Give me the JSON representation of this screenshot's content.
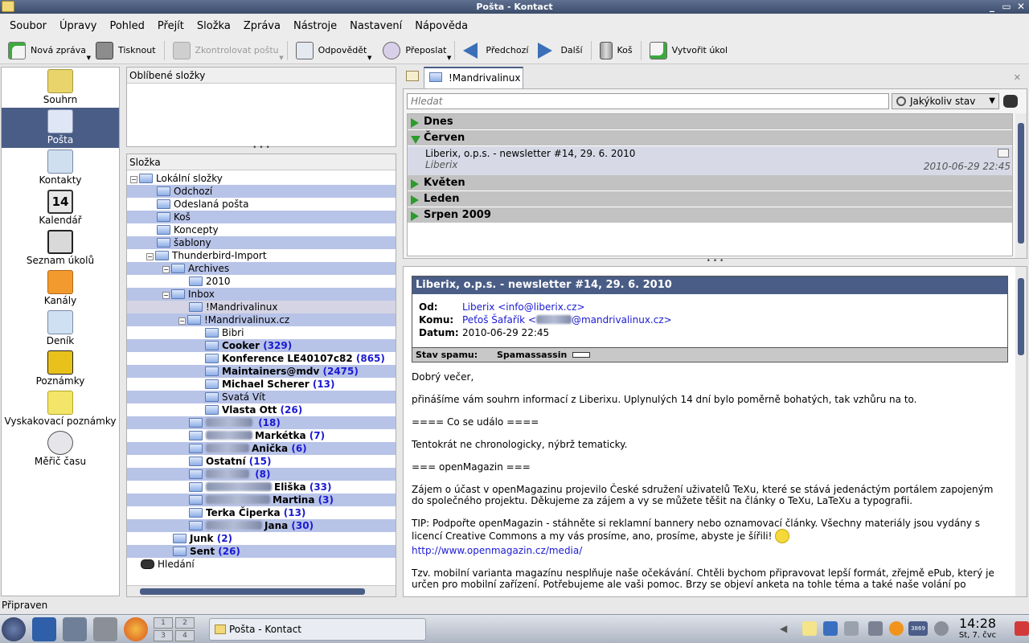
{
  "window": {
    "title": "Pošta - Kontact",
    "buttons": [
      "_",
      "▭",
      "✕"
    ]
  },
  "menu": [
    "Soubor",
    "Úpravy",
    "Pohled",
    "Přejít",
    "Složka",
    "Zpráva",
    "Nástroje",
    "Nastavení",
    "Nápověda"
  ],
  "toolbar": {
    "new_message": "Nová zpráva",
    "print": "Tisknout",
    "check_mail": "Zkontrolovat poštu",
    "reply": "Odpovědět",
    "forward": "Přeposlat",
    "previous": "Předchozí",
    "next": "Další",
    "trash": "Koš",
    "create_task": "Vytvořit úkol"
  },
  "sidebar": {
    "items": [
      {
        "label": "Souhrn",
        "icon": "summary-icon",
        "color": "#e8d46a"
      },
      {
        "label": "Pošta",
        "icon": "mail-icon",
        "color": "#dfe6f5",
        "active": true
      },
      {
        "label": "Kontakty",
        "icon": "contacts-icon",
        "color": "#cfdff0"
      },
      {
        "label": "Kalendář",
        "icon": "calendar-icon",
        "color": "#e6e6e6",
        "badge": "14"
      },
      {
        "label": "Seznam úkolů",
        "icon": "todo-icon",
        "color": "#d9d9d9"
      },
      {
        "label": "Kanály",
        "icon": "feeds-icon",
        "color": "#f29a2e"
      },
      {
        "label": "Deník",
        "icon": "journal-icon",
        "color": "#cfe0f2"
      },
      {
        "label": "Poznámky",
        "icon": "notes-icon",
        "color": "#e8c21a"
      },
      {
        "label": "Vyskakovací poznámky",
        "icon": "popup-notes-icon",
        "color": "#f2e56a"
      },
      {
        "label": "Měřič času",
        "icon": "timer-icon",
        "color": "#e6e6ea"
      }
    ]
  },
  "favorites": {
    "title": "Oblíbené složky"
  },
  "folders": {
    "title": "Složka",
    "rows": [
      {
        "label": "Lokální složky",
        "depth": 0,
        "expand": "−",
        "bold": false,
        "count": ""
      },
      {
        "label": "Odchozí",
        "depth": 1,
        "bold": false,
        "count": ""
      },
      {
        "label": "Odeslaná pošta",
        "depth": 1,
        "bold": false,
        "count": ""
      },
      {
        "label": "Koš",
        "depth": 1,
        "bold": false,
        "count": ""
      },
      {
        "label": "Koncepty",
        "depth": 1,
        "bold": false,
        "count": ""
      },
      {
        "label": "šablony",
        "depth": 1,
        "bold": false,
        "count": ""
      },
      {
        "label": "Thunderbird-Import",
        "depth": 1,
        "expand": "−",
        "bold": false,
        "count": ""
      },
      {
        "label": "Archives",
        "depth": 2,
        "expand": "−",
        "bold": false,
        "count": ""
      },
      {
        "label": "2010",
        "depth": 3,
        "bold": false,
        "count": ""
      },
      {
        "label": "Inbox",
        "depth": 2,
        "expand": "−",
        "bold": false,
        "count": ""
      },
      {
        "label": "!Mandrivalinux",
        "depth": 3,
        "bold": false,
        "count": "",
        "selected": true
      },
      {
        "label": "!Mandrivalinux.cz",
        "depth": 3,
        "expand": "−",
        "bold": false,
        "count": ""
      },
      {
        "label": "Bibri",
        "depth": 4,
        "bold": false,
        "count": ""
      },
      {
        "label": "Cooker",
        "depth": 4,
        "bold": true,
        "count": "(329)"
      },
      {
        "label": "Konference LE40107c82",
        "depth": 4,
        "bold": true,
        "count": "(865)"
      },
      {
        "label": "Maintainers@mdv",
        "depth": 4,
        "bold": true,
        "count": "(2475)"
      },
      {
        "label": "Michael Scherer",
        "depth": 4,
        "bold": true,
        "count": "(13)"
      },
      {
        "label": "Svatá Vít",
        "depth": 4,
        "bold": false,
        "count": ""
      },
      {
        "label": "Vlasta Ott",
        "depth": 4,
        "bold": true,
        "count": "(26)"
      },
      {
        "label": "",
        "depth": 3,
        "bold": true,
        "count": "(18)",
        "blur": 58
      },
      {
        "label": "Markétka",
        "depth": 3,
        "bold": true,
        "count": "(7)",
        "blur": 58
      },
      {
        "label": "Anička",
        "depth": 3,
        "bold": true,
        "count": "(6)",
        "blur": 54
      },
      {
        "label": "Ostatní",
        "depth": 3,
        "bold": true,
        "count": "(15)"
      },
      {
        "label": "",
        "depth": 3,
        "bold": true,
        "count": "(8)",
        "blur": 54
      },
      {
        "label": "Eliška",
        "depth": 3,
        "bold": true,
        "count": "(33)",
        "blur": 82
      },
      {
        "label": "Martina",
        "depth": 3,
        "bold": true,
        "count": "(3)",
        "blur": 80
      },
      {
        "label": "Terka Čiperka",
        "depth": 3,
        "bold": true,
        "count": "(13)"
      },
      {
        "label": "Jana",
        "depth": 3,
        "bold": true,
        "count": "(30)",
        "blur": 70
      },
      {
        "label": "Junk",
        "depth": 2,
        "bold": true,
        "count": "(2)"
      },
      {
        "label": "Sent",
        "depth": 2,
        "bold": true,
        "count": "(26)"
      },
      {
        "label": "Hledání",
        "depth": 0,
        "bold": false,
        "count": "",
        "icon": "binoculars"
      }
    ]
  },
  "tab": {
    "label": "!Mandrivalinux"
  },
  "search": {
    "placeholder": "Hledat",
    "status": "Jakýkoliv stav"
  },
  "message_list": {
    "groups": [
      "Dnes",
      "Červen",
      "Květen",
      "Leden",
      "Srpen 2009"
    ],
    "message": {
      "subject": "Liberix, o.p.s. - newsletter #14, 29. 6. 2010",
      "from": "Liberix",
      "date": "2010-06-29 22:45"
    }
  },
  "reader": {
    "subject": "Liberix, o.p.s. - newsletter #14, 29. 6. 2010",
    "from_label": "Od:",
    "from": "Liberix <info@liberix.cz>",
    "to_label": "Komu:",
    "to_pre": "Peťoš Šafařík <",
    "to_post": "@mandrivalinux.cz>",
    "date_label": "Datum:",
    "date": "2010-06-29 22:45",
    "spam_label": "Stav spamu:",
    "spam_engine": "Spamassassin",
    "body": {
      "p1": "Dobrý večer,",
      "p2": "přinášíme vám souhrn informací z Liberixu. Uplynulých 14 dní bylo poměrně bohatých, tak vzhůru na to.",
      "p3": "==== Co se událo ====",
      "p4": "Tentokrát ne chronologicky, nýbrž tematicky.",
      "p5": "=== openMagazin ===",
      "p6": "Zájem o účast v openMagazinu projevilo České sdružení uživatelů TeXu, které se stává jedenáctým portálem zapojeným do společného projektu. Děkujeme za zájem a vy se můžete těšit na články o TeXu, LaTeXu a typografii.",
      "p7": "TIP: Podpořte openMagazin - stáhněte si reklamní bannery nebo oznamovací články. Všechny materiály jsou vydány s licencí Creative Commons a my vás prosíme, ano, prosíme, abyste je šířili!",
      "link": "http://www.openmagazin.cz/media/",
      "p8": "Tzv. mobilní varianta magazínu nesplňuje naše očekávání. Chtěli bychom připravovat lepší formát, zřejmě ePub, který je určen pro mobilní zařízení. Potřebujeme ale vaši pomoc. Brzy se objeví anketa na tohle téma a také naše volání po"
    }
  },
  "statusbar": {
    "text": "Připraven"
  },
  "taskbar": {
    "pager": [
      "1",
      "2",
      "3",
      "4"
    ],
    "task": "Pošta - Kontact",
    "time": "14:28",
    "date": "St, 7. čvc",
    "tray_badge": "3869"
  },
  "colors": {
    "accent": "#4a5d86",
    "alt_row": "#b8c3e8",
    "link": "#1a1ad4",
    "group_header": "#c2c2c2",
    "expand_arrow": "#2b9b2b"
  }
}
